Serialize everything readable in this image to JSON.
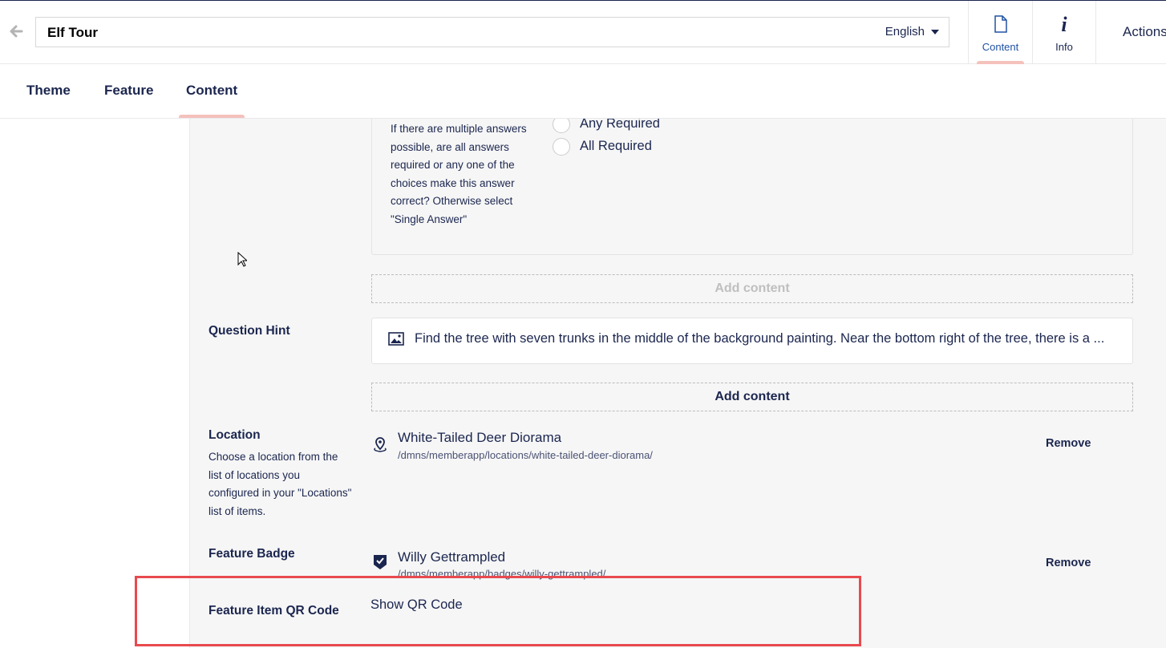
{
  "header": {
    "title": "Elf Tour",
    "language": "English",
    "app_tabs": [
      {
        "label": "Content",
        "icon": "document-icon",
        "active": true
      },
      {
        "label": "Info",
        "icon": "info-icon",
        "active": false
      }
    ],
    "actions_label": "Actions"
  },
  "subtabs": [
    {
      "label": "Theme",
      "active": false
    },
    {
      "label": "Feature",
      "active": false
    },
    {
      "label": "Content",
      "active": true
    }
  ],
  "question": {
    "answer_mode_description": "If there are multiple answers possible, are all answers required or any one of the choices make this answer correct? Otherwise select \"Single Answer\"",
    "options": [
      "Any Required",
      "All Required"
    ]
  },
  "add_content_label": "Add content",
  "question_hint": {
    "label": "Question Hint",
    "text": "Find the tree with seven trunks in the middle of the background painting. Near the bottom right of the tree, there is a ..."
  },
  "location": {
    "label": "Location",
    "description": "Choose a location from the list of locations you configured in your \"Locations\" list of items.",
    "name": "White-Tailed Deer Diorama",
    "path": "/dmns/memberapp/locations/white-tailed-deer-diorama/",
    "remove_label": "Remove"
  },
  "feature_badge": {
    "label": "Feature Badge",
    "name": "Willy Gettrampled",
    "path": "/dmns/memberapp/badges/willy-gettrampled/",
    "remove_label": "Remove"
  },
  "qr_code": {
    "label": "Feature Item QR Code",
    "value": "Show QR Code"
  },
  "colors": {
    "navy": "#1b264f",
    "accent_tab": "#f5c1bc",
    "highlight": "#e84a4f"
  }
}
